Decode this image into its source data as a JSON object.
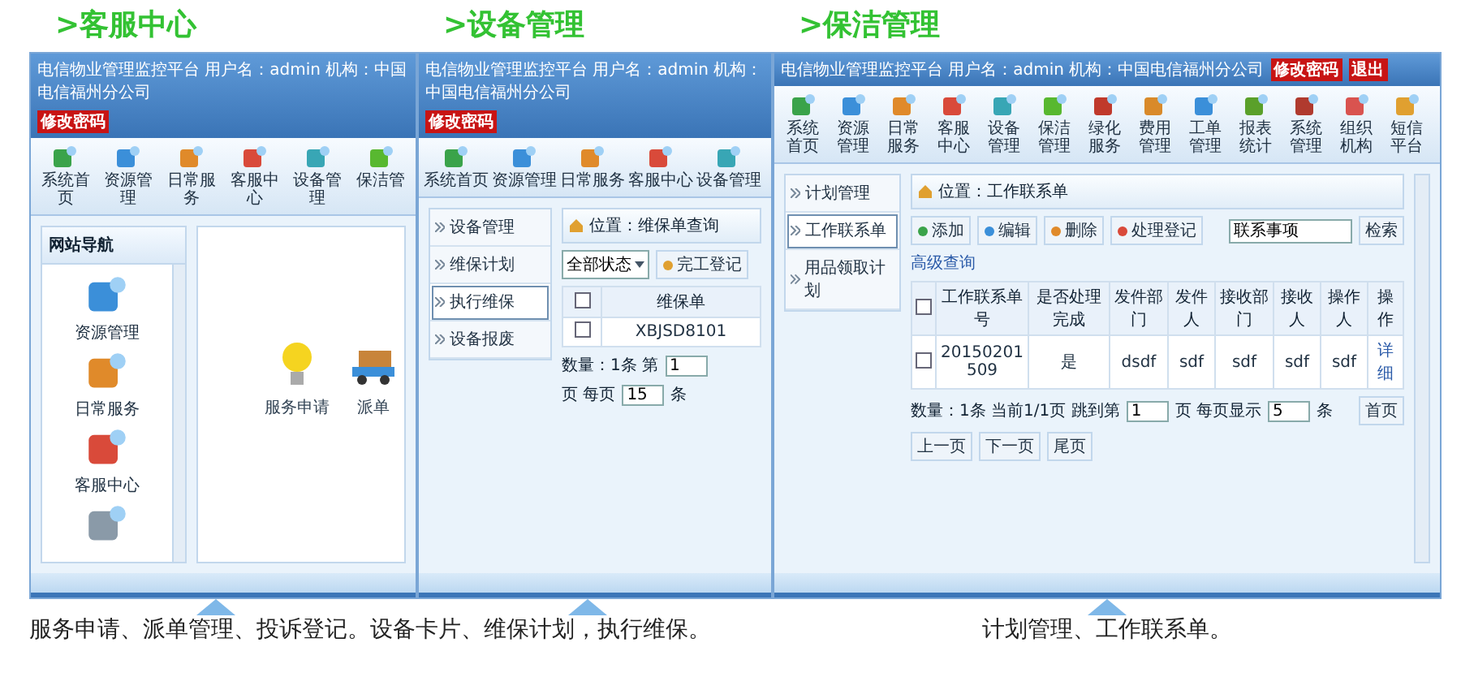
{
  "headings": [
    ">客服中心",
    ">设备管理",
    ">保洁管理"
  ],
  "windows": [
    {
      "kind": "portal",
      "title": "电信物业管理监控平台 用户名：admin 机构：中国电信福州分公司",
      "links": [
        "修改密码"
      ],
      "toolbar": [
        "系统首页",
        "资源管理",
        "日常服务",
        "客服中心",
        "设备管理",
        "保洁管"
      ],
      "nav_title": "网站导航",
      "nav_items": [
        {
          "kind": "labeled",
          "label": "资源管理"
        },
        {
          "kind": "labeled",
          "label": "日常服务"
        },
        {
          "kind": "labeled",
          "label": "客服中心"
        },
        {
          "kind": "icon_only"
        }
      ],
      "shortcuts": [
        {
          "kind": "bulb",
          "label": "服务申请"
        },
        {
          "kind": "truck",
          "label": "派单"
        }
      ]
    },
    {
      "kind": "maintenance",
      "title": "电信物业管理监控平台 用户名：admin 机构：中国电信福州分公司",
      "links": [
        "修改密码"
      ],
      "toolbar": [
        "系统首页",
        "资源管理",
        "日常服务",
        "客服中心",
        "设备管理"
      ],
      "menu": [
        {
          "label": "设备管理",
          "selected": false
        },
        {
          "label": "维保计划",
          "selected": false
        },
        {
          "label": "执行维保",
          "selected": true
        },
        {
          "label": "设备报废",
          "selected": false
        }
      ],
      "location": "位置：维保单查询",
      "filter": "全部状态",
      "action": "完工登记",
      "table": {
        "header_checked": false,
        "columns": [
          {
            "label": "维保单",
            "kind": "text"
          }
        ],
        "rows": [
          {
            "checked": false,
            "cells": [
              "XBJSD8101"
            ]
          }
        ]
      },
      "pager": [
        {
          "kind": "text",
          "text": "数量：1条 第"
        },
        {
          "kind": "input",
          "value": "1"
        },
        {
          "kind": "text",
          "text": "页 每页"
        },
        {
          "kind": "input",
          "value": "15"
        },
        {
          "kind": "text",
          "text": "条"
        }
      ]
    },
    {
      "kind": "cleaning",
      "title": "电信物业管理监控平台 用户名：admin 机构：中国电信福州分公司",
      "links": [
        "修改密码",
        "退出"
      ],
      "toolbar": [
        "系统首页",
        "资源管理",
        "日常服务",
        "客服中心",
        "设备管理",
        "保洁管理",
        "绿化服务",
        "费用管理",
        "工单管理",
        "报表统计",
        "系统管理",
        "组织机构",
        "短信平台"
      ],
      "menu": [
        {
          "label": "计划管理",
          "selected": false
        },
        {
          "label": "工作联系单",
          "selected": true
        },
        {
          "label": "用品领取计划",
          "selected": false
        }
      ],
      "location": "位置：工作联系单",
      "actions": [
        "添加",
        "编辑",
        "删除",
        "处理登记"
      ],
      "search": {
        "value": "联系事项",
        "button": "检索",
        "link": "高级查询"
      },
      "table": {
        "header_checked": false,
        "columns": [
          {
            "label": "工作联系单号",
            "kind": "text"
          },
          {
            "label": "是否处理完成",
            "kind": "text"
          },
          {
            "label": "发件部门",
            "kind": "text"
          },
          {
            "label": "发件人",
            "kind": "text"
          },
          {
            "label": "接收部门",
            "kind": "text"
          },
          {
            "label": "接收人",
            "kind": "text"
          },
          {
            "label": "操作人",
            "kind": "text"
          },
          {
            "label": "操作",
            "kind": "link"
          }
        ],
        "rows": [
          {
            "checked": false,
            "cells": [
              "20150201509",
              "是",
              "dsdf",
              "sdf",
              "sdf",
              "sdf",
              "sdf",
              "详细"
            ]
          }
        ]
      },
      "pager": [
        {
          "kind": "text",
          "text": "数量：1条 当前1/1页 跳到第"
        },
        {
          "kind": "input",
          "value": "1"
        },
        {
          "kind": "text",
          "text": "页 每页显示"
        },
        {
          "kind": "input",
          "value": "5"
        },
        {
          "kind": "text",
          "text": "条"
        }
      ],
      "pager_buttons": [
        "首页",
        "上一页",
        "下一页",
        "尾页"
      ]
    }
  ],
  "captions": [
    "服务申请、派单管理、投诉登记。设备卡片、维保计划，执行维保。",
    "计划管理、工作联系单。"
  ]
}
